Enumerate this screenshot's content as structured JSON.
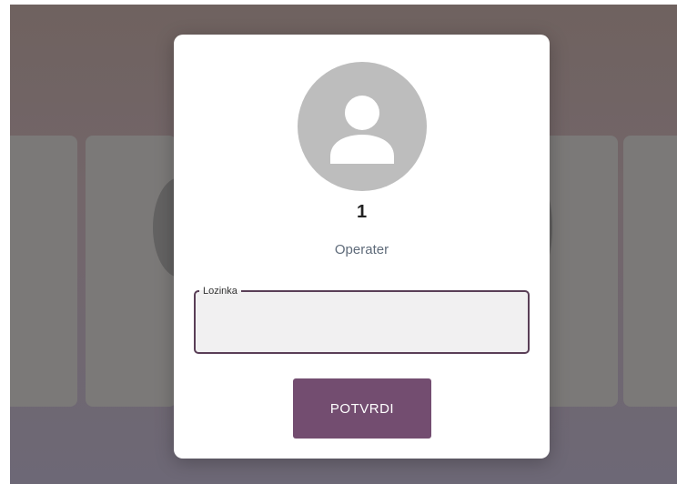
{
  "login_dialog": {
    "avatar_icon": "user-avatar-icon",
    "user_name": "1",
    "user_role": "Operater",
    "password": {
      "label": "Lozinka",
      "value": "",
      "placeholder": ""
    },
    "confirm_label": "POTVRDI"
  },
  "colors": {
    "accent": "#734d70",
    "field_border": "#5a3f57",
    "avatar_bg": "#bdbdbd",
    "overlay": "#6f625f"
  }
}
